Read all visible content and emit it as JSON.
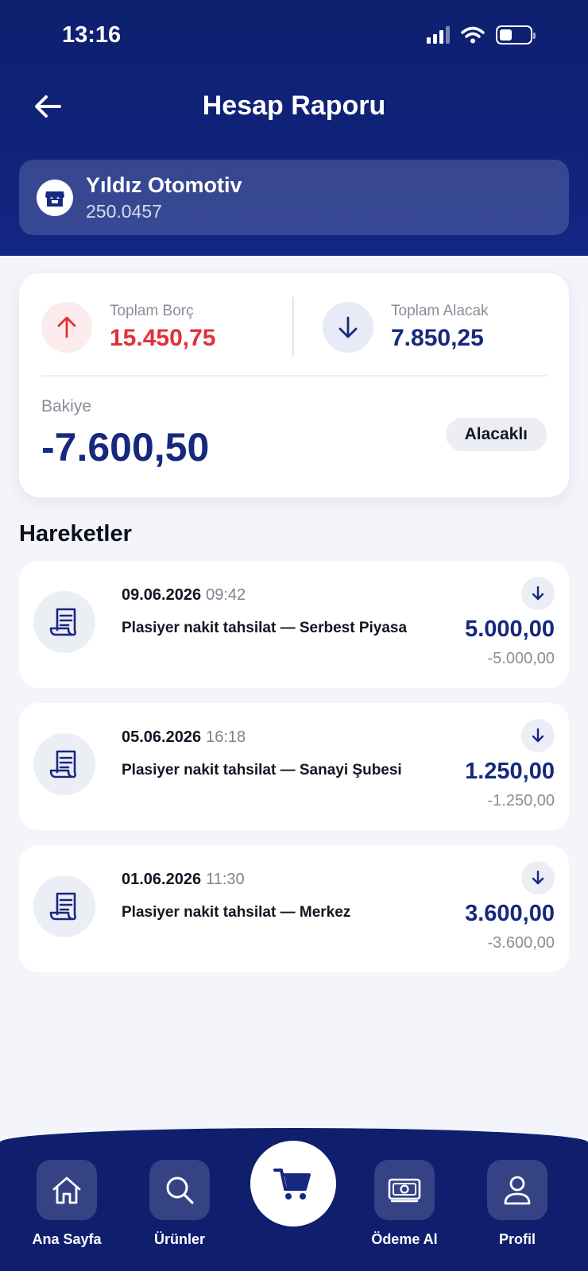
{
  "status_bar": {
    "time": "13:16"
  },
  "header": {
    "title": "Hesap Raporu"
  },
  "account": {
    "name": "Yıldız Otomotiv",
    "code": "250.0457"
  },
  "summary": {
    "total_debt_label": "Toplam Borç",
    "total_debt_value": "15.450,75",
    "total_credit_label": "Toplam Alacak",
    "total_credit_value": "7.850,25",
    "balance_label": "Bakiye",
    "balance_value": "-7.600,50",
    "balance_badge": "Alacaklı"
  },
  "section": {
    "title": "Hareketler"
  },
  "transactions": [
    {
      "date": "09.06.2026",
      "time": "09:42",
      "description": "Plasiyer nakit tahsilat — Serbest Piyasa",
      "amount": "5.000,00",
      "balance": "-5.000,00"
    },
    {
      "date": "05.06.2026",
      "time": "16:18",
      "description": "Plasiyer nakit tahsilat — Sanayi Şubesi",
      "amount": "1.250,00",
      "balance": "-1.250,00"
    },
    {
      "date": "01.06.2026",
      "time": "11:30",
      "description": "Plasiyer nakit tahsilat — Merkez",
      "amount": "3.600,00",
      "balance": "-3.600,00"
    }
  ],
  "nav": {
    "home": "Ana Sayfa",
    "products": "Ürünler",
    "payment": "Ödeme Al",
    "profile": "Profil"
  },
  "colors": {
    "primary": "#122683",
    "debt_red": "#E0303A",
    "amount_blue": "#16287F",
    "background": "#F4F5FA"
  },
  "icons": {
    "back": "arrow-left-icon",
    "store": "store-icon",
    "debt": "arrow-up-icon",
    "credit": "arrow-down-icon",
    "transaction": "receipt-icon",
    "home": "home-icon",
    "search": "search-icon",
    "cart": "cart-icon",
    "payment": "cash-icon",
    "profile": "user-icon"
  }
}
